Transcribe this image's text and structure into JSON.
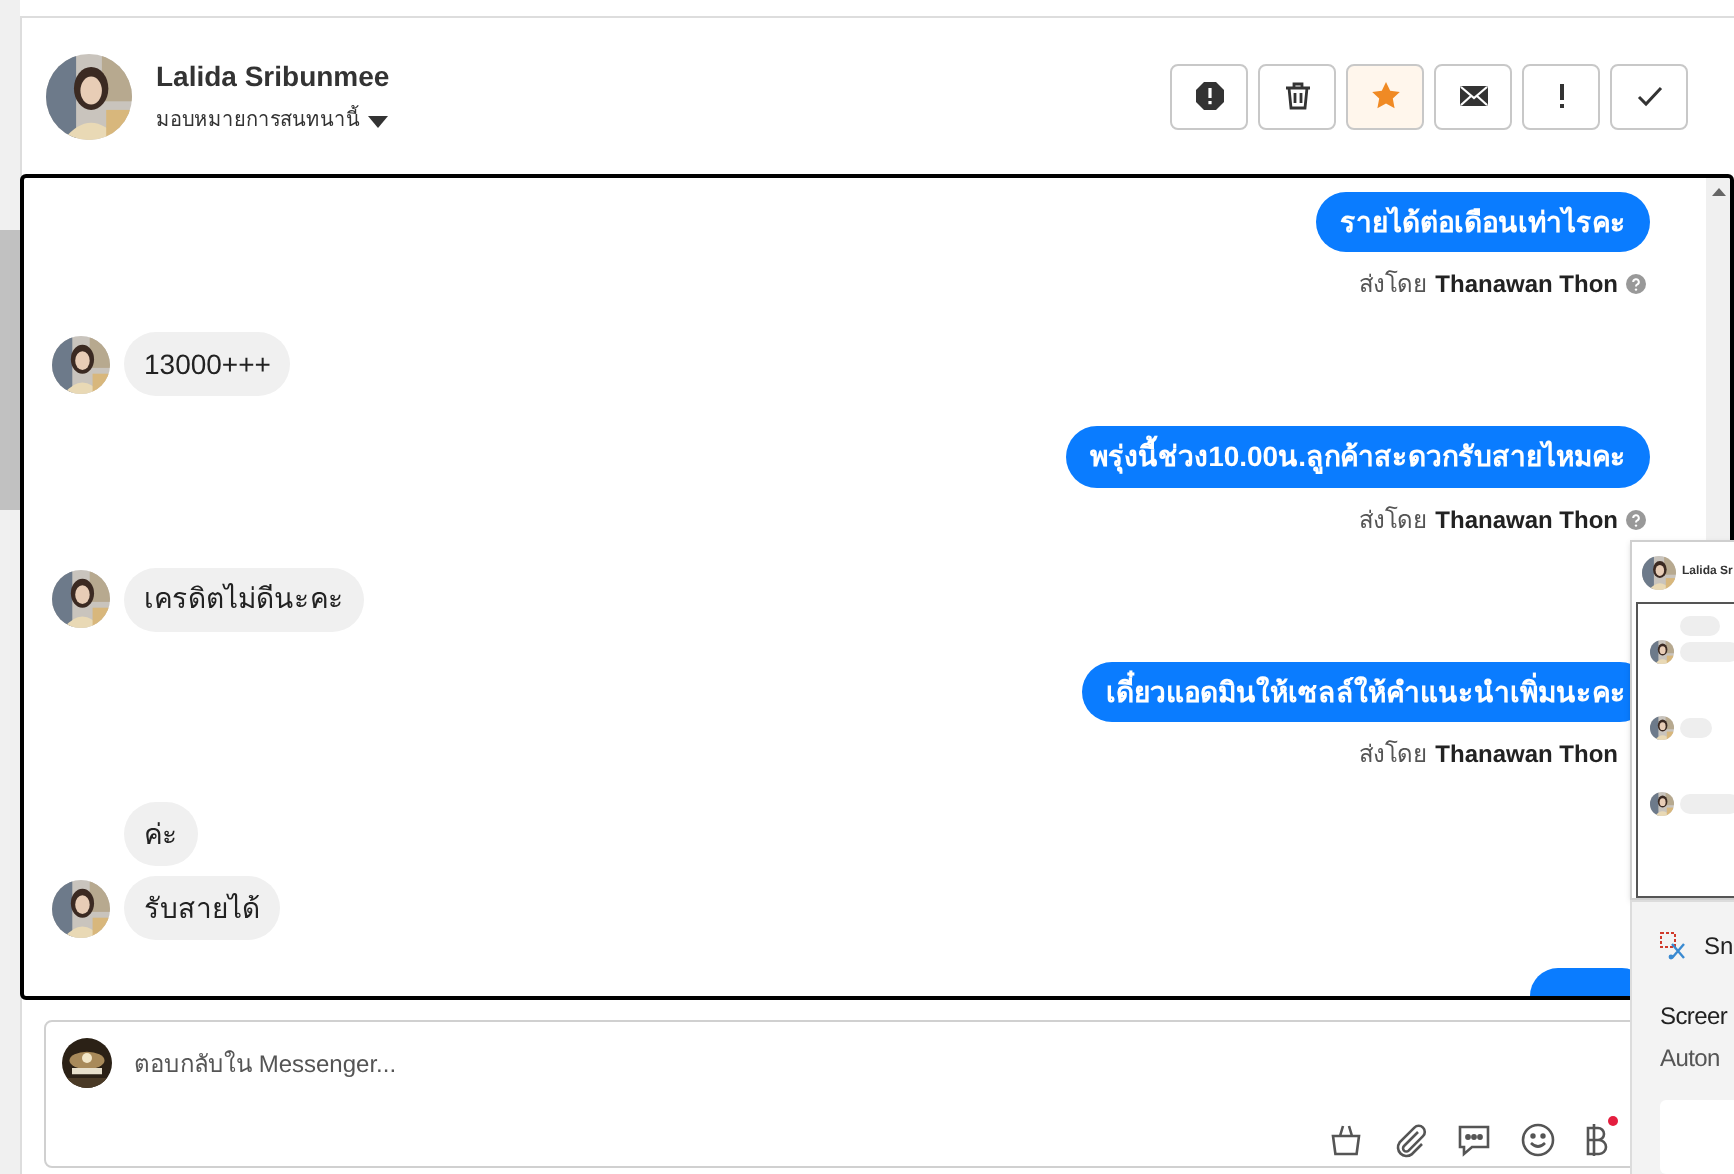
{
  "header": {
    "name": "Lalida Sribunmee",
    "subtitle": "มอบหมายการสนทนานี้"
  },
  "actions": [
    {
      "kind": "spam"
    },
    {
      "kind": "delete"
    },
    {
      "kind": "star",
      "selected": true
    },
    {
      "kind": "unread"
    },
    {
      "kind": "important"
    },
    {
      "kind": "done"
    }
  ],
  "messages": [
    {
      "kind": "outgoing",
      "text": "รายได้ต่อเดือนเท่าไรคะ",
      "sent_by_label": "ส่งโดย",
      "sender": "Thanawan Thon",
      "help_icon": true
    },
    {
      "kind": "incoming",
      "text": "13000+++",
      "avatar": true
    },
    {
      "kind": "outgoing",
      "text": "พรุ่งนี้ช่วง10.00น.ลูกค้าสะดวกรับสายไหมคะ",
      "sent_by_label": "ส่งโดย",
      "sender": "Thanawan Thon",
      "help_icon": true
    },
    {
      "kind": "incoming",
      "text": "เครดิตไม่ดีนะคะ",
      "avatar": true
    },
    {
      "kind": "outgoing",
      "text": "เดี๋ยวแอดมินให้เซลล์ให้คำแนะนำเพิ่มนะคะ",
      "sent_by_label": "ส่งโดย",
      "sender": "Thanawan Thon",
      "help_icon": false
    },
    {
      "kind": "incoming",
      "text": "ค่ะ",
      "avatar": false
    },
    {
      "kind": "incoming",
      "text": "รับสายได้",
      "avatar": true
    },
    {
      "kind": "outgoing_cut"
    }
  ],
  "composer": {
    "placeholder": "ตอบกลับใน Messenger..."
  },
  "composer_tools": [
    {
      "kind": "bag"
    },
    {
      "kind": "attach"
    },
    {
      "kind": "chat"
    },
    {
      "kind": "emoji"
    },
    {
      "kind": "baht",
      "badge": true
    }
  ],
  "snip_preview": {
    "name": "Lalida Sr"
  },
  "snip_notification": {
    "app": "Sn",
    "title": "Screer",
    "body": "Auton"
  }
}
